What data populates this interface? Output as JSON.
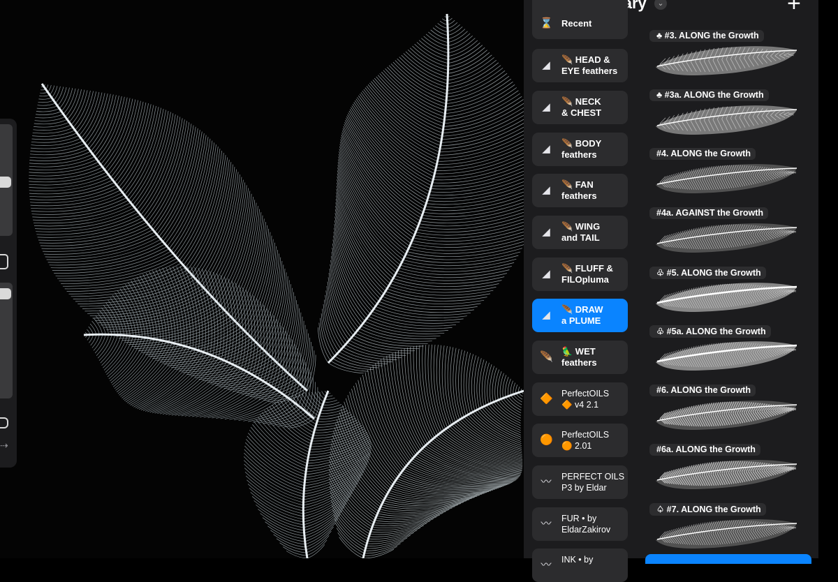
{
  "library": {
    "title": "Classic Library",
    "chevron": "⌄",
    "add": "+",
    "accent": "#0a84ff"
  },
  "sidebar": {
    "redo": "⇢"
  },
  "brush_sets": [
    {
      "icon": "hourglass-icon",
      "thumb": "⌛",
      "label": "Recent"
    },
    {
      "icon": "feather-icon",
      "thumb": "◢",
      "label": "🪶 HEAD &\nEYE feathers"
    },
    {
      "icon": "feather-icon",
      "thumb": "◢",
      "label": "🪶 NECK\n& CHEST"
    },
    {
      "icon": "feather-icon",
      "thumb": "◢",
      "label": "🪶 BODY\nfeathers"
    },
    {
      "icon": "feather-icon",
      "thumb": "◢",
      "label": "🪶 FAN\nfeathers"
    },
    {
      "icon": "feather-icon",
      "thumb": "◢",
      "label": "🪶 WING\nand TAIL"
    },
    {
      "icon": "feather-icon",
      "thumb": "◢",
      "label": "🪶 FLUFF &\nFILOpluma"
    },
    {
      "icon": "feather-icon",
      "thumb": "◢",
      "label": "🪶 DRAW\na PLUME",
      "active": true
    },
    {
      "icon": "feather-icon",
      "thumb": "🪶",
      "label": "🦜 WET\nfeathers"
    },
    {
      "icon": "diamond-icon",
      "thumb": "🔶",
      "label": "PerfectOILS\n🔶 v4 2.1"
    },
    {
      "icon": "orange-circle-icon",
      "thumb": "🟠",
      "label": "PerfectOILS\n🟠 2.01"
    },
    {
      "icon": "brush-stroke-icon",
      "thumb": "〰",
      "label": "PERFECT OILS\nP3 by Eldar"
    },
    {
      "icon": "brush-stroke-icon",
      "thumb": "〰",
      "label": "FUR • by\nEldarZakirov"
    },
    {
      "icon": "brush-stroke-icon",
      "thumb": "〰",
      "label": "INK • by"
    }
  ],
  "brushes": [
    {
      "label": "♣ #3. ALONG the Growth",
      "style": "smooth"
    },
    {
      "label": "♣ #3a. ALONG the Growth",
      "style": "smooth"
    },
    {
      "label": "#4. ALONG the Growth",
      "style": "fine"
    },
    {
      "label": "#4a. AGAINST the Growth",
      "style": "fine"
    },
    {
      "label": "♧ #5. ALONG the Growth",
      "style": "bright"
    },
    {
      "label": "♧ #5a. ALONG the Growth",
      "style": "bright"
    },
    {
      "label": "#6. ALONG the Growth",
      "style": "coarse"
    },
    {
      "label": "#6a. ALONG the Growth",
      "style": "coarse"
    },
    {
      "label": "♤ #7. ALONG the Growth",
      "style": "fine"
    }
  ]
}
